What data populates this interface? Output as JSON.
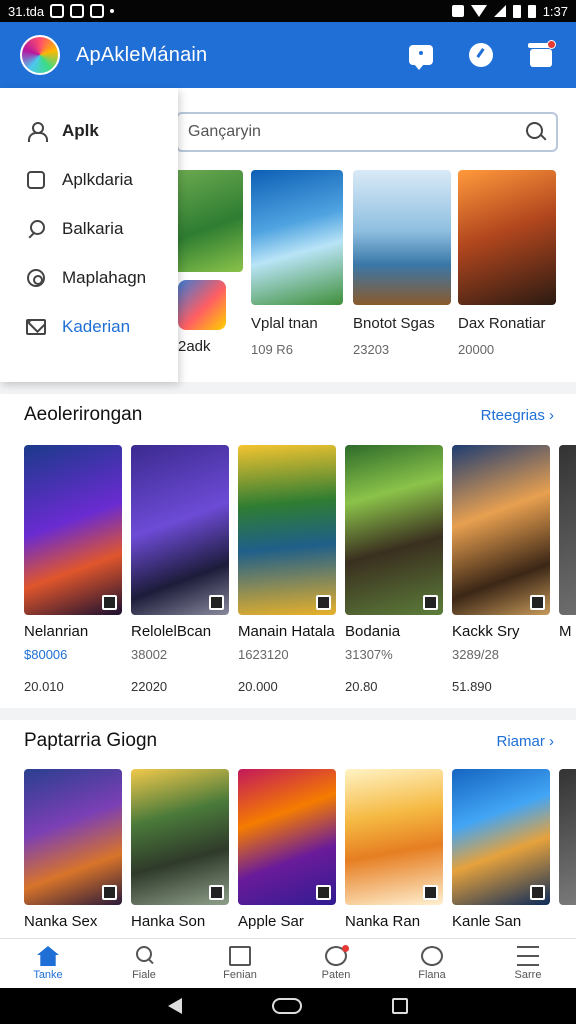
{
  "status_bar": {
    "carrier": "31.tda",
    "time": "1:37"
  },
  "app_bar": {
    "title": "ApAkleMánain"
  },
  "drawer": {
    "items": [
      {
        "label": "Aplk",
        "icon": "user-icon"
      },
      {
        "label": "Aplkdaria",
        "icon": "apps-icon"
      },
      {
        "label": "Balkaria",
        "icon": "search-icon"
      },
      {
        "label": "Maplahagn",
        "icon": "target-icon"
      },
      {
        "label": "Kaderian",
        "icon": "mail-icon"
      }
    ]
  },
  "search": {
    "placeholder": "Gançaryin"
  },
  "top_row": {
    "items": [
      {
        "name": "",
        "sub": ""
      },
      {
        "name": "2adk",
        "sub": ""
      },
      {
        "name": "Vplal tnan",
        "sub": "109 R6"
      },
      {
        "name": "Bnotot Sgas",
        "sub": "23203"
      },
      {
        "name": "Dax Ronatiar",
        "sub": "20000"
      }
    ]
  },
  "section1": {
    "title": "Aeolerirongan",
    "see_all": "Rteegrias ›",
    "items": [
      {
        "name": "Nelanrian",
        "price": "$80006",
        "downloads": "20.010"
      },
      {
        "name": "RelolelBcan",
        "price": "38002",
        "downloads": "22020"
      },
      {
        "name": "Manain Hatala",
        "price": "1623120",
        "downloads": "20.000"
      },
      {
        "name": "Bodania",
        "price": "31307%",
        "downloads": "20.80"
      },
      {
        "name": "Kackk Sry",
        "price": "3289/28",
        "downloads": "51.890"
      },
      {
        "name": "M",
        "price": "",
        "downloads": ""
      }
    ]
  },
  "section2": {
    "title": "Paptarria Giogn",
    "see_all": "Riamar ›",
    "items": [
      {
        "name": "Nanka Sex"
      },
      {
        "name": "Hanka Son"
      },
      {
        "name": "Apple Sar"
      },
      {
        "name": "Nanka Ran"
      },
      {
        "name": "Kanle San"
      },
      {
        "name": ""
      }
    ]
  },
  "bottom_nav": {
    "items": [
      {
        "label": "Tanke"
      },
      {
        "label": "Fiale"
      },
      {
        "label": "Fenian"
      },
      {
        "label": "Paten"
      },
      {
        "label": "Flana"
      },
      {
        "label": "Sarre"
      }
    ]
  },
  "colors": {
    "brand": "#1f6fd6",
    "notification": "#e53935"
  }
}
